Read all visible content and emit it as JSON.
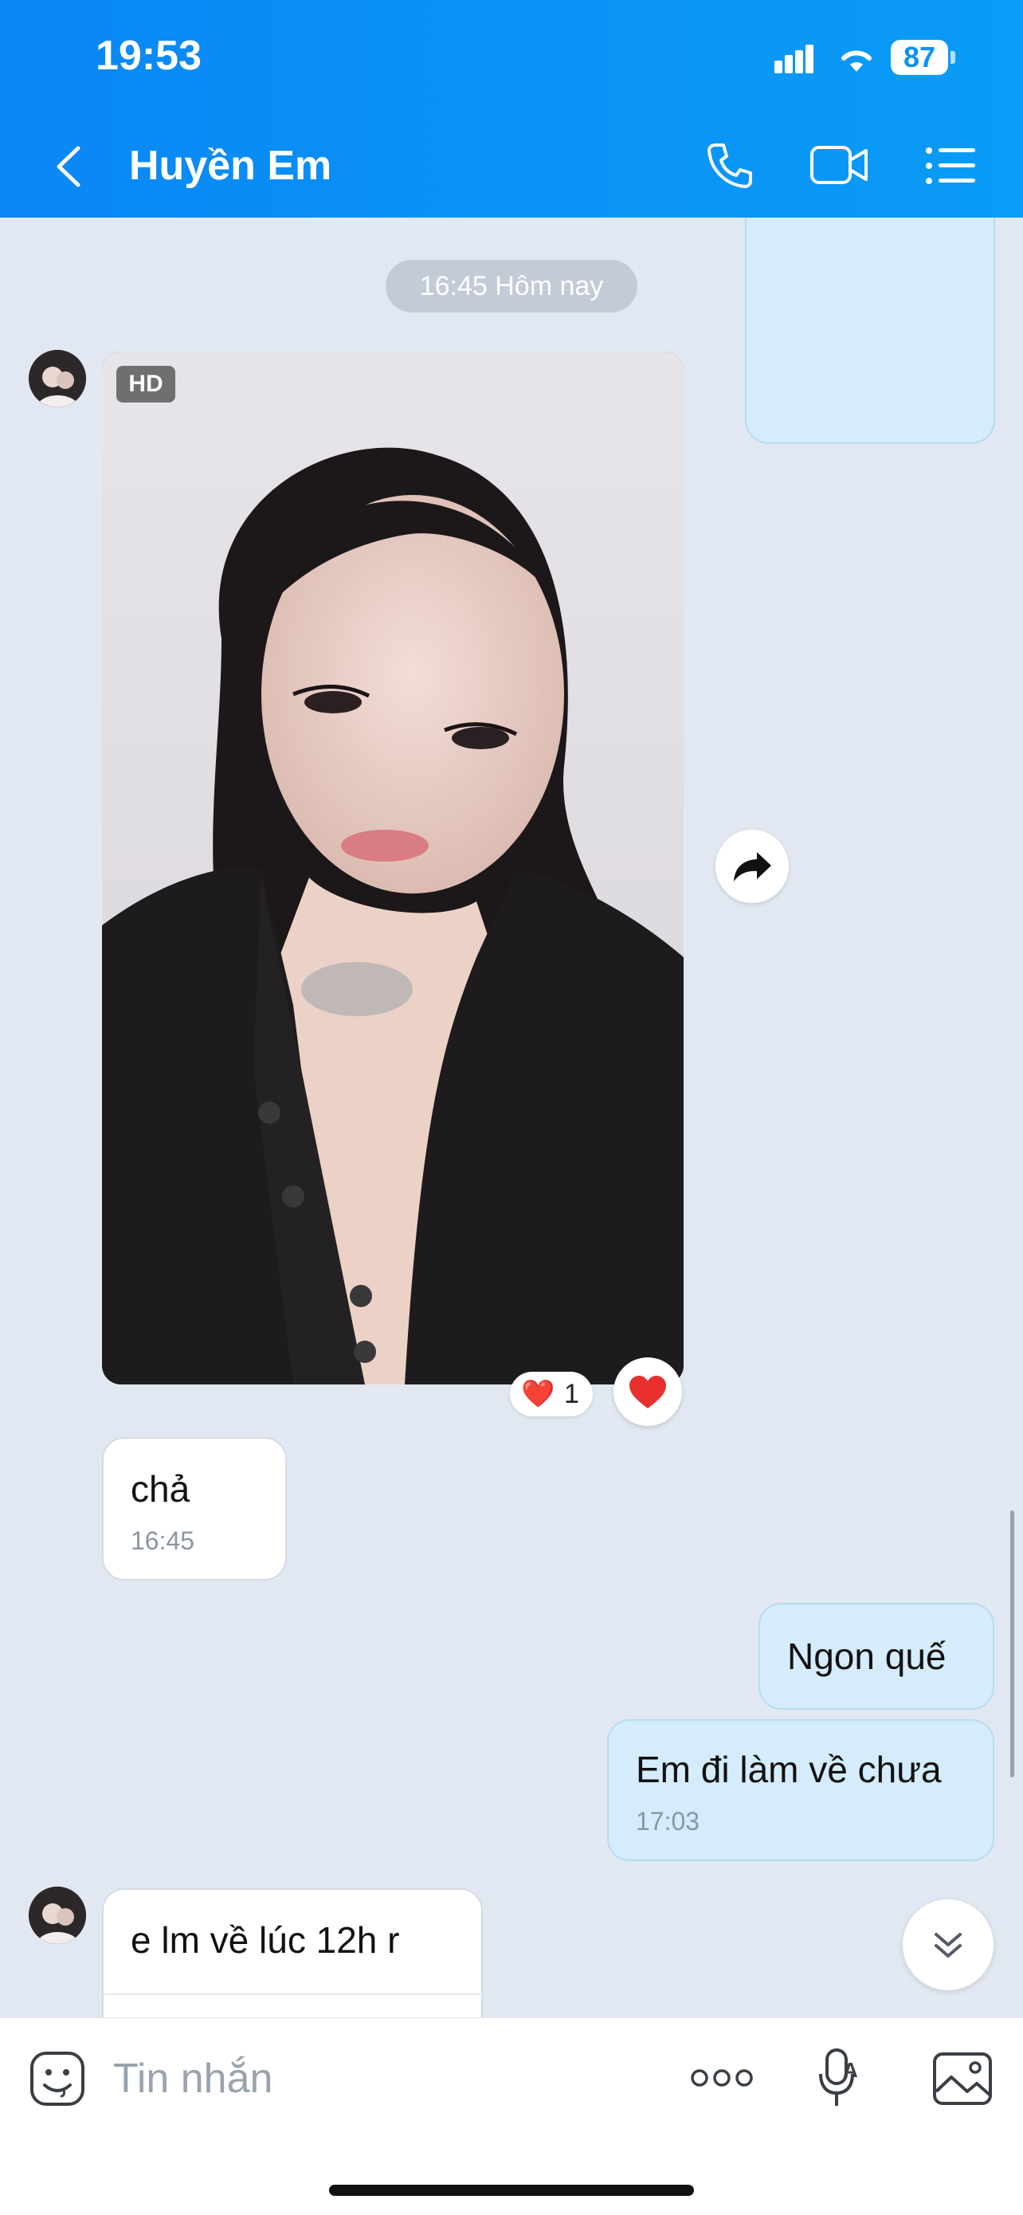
{
  "status_bar": {
    "time": "19:53",
    "battery": "87"
  },
  "header": {
    "back_icon": "chevron-left-icon",
    "title": "Huyền Em",
    "icons": [
      "phone-icon",
      "video-camera-icon",
      "list-menu-icon"
    ]
  },
  "chat": {
    "date_divider": "16:45 Hôm nay",
    "photo": {
      "badge": "HD",
      "reaction_emoji": "❤️",
      "reaction_count": "1"
    },
    "messages": [
      {
        "side": "in",
        "text": "chả",
        "time": "16:45"
      },
      {
        "side": "out",
        "text": "Ngon quế",
        "time": ""
      },
      {
        "side": "out",
        "text": "Em đi làm về chưa",
        "time": "17:03"
      },
      {
        "side": "in",
        "text": "e lm về lúc 12h r",
        "time": ""
      }
    ]
  },
  "composer": {
    "placeholder": "Tin nhắn",
    "icons": [
      "sticker-icon",
      "more-dots-icon",
      "voice-to-text-icon",
      "image-icon"
    ]
  },
  "colors": {
    "header_gradient_start": "#0a87f5",
    "header_gradient_end": "#0a9cf6",
    "chat_background": "#e2e8f1",
    "outgoing_bubble": "#d4ecfb",
    "incoming_bubble": "#ffffff"
  }
}
